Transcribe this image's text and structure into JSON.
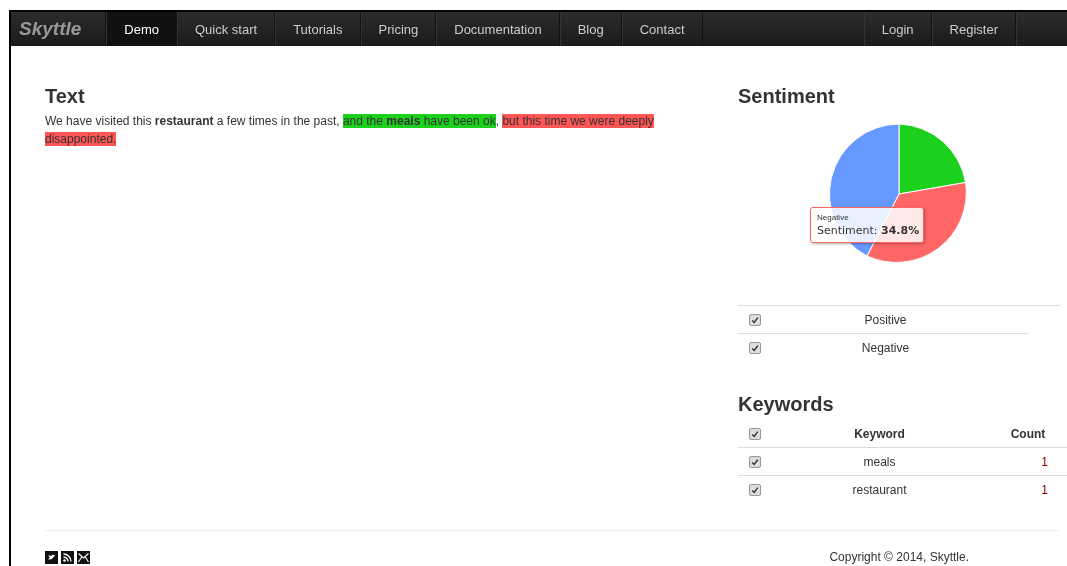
{
  "navbar": {
    "brand": "Skyttle",
    "items": [
      {
        "label": "Demo",
        "selected": true
      },
      {
        "label": "Quick start",
        "selected": false
      },
      {
        "label": "Tutorials",
        "selected": false
      },
      {
        "label": "Pricing",
        "selected": false
      },
      {
        "label": "Documentation",
        "selected": false
      },
      {
        "label": "Blog",
        "selected": false
      },
      {
        "label": "Contact",
        "selected": false
      }
    ],
    "right_items": [
      {
        "label": "Login"
      },
      {
        "label": "Register"
      }
    ]
  },
  "text_section": {
    "title": "Text",
    "segments": [
      {
        "kind": "plain",
        "text": "We have visited this **restaurant** a few times in the past, "
      },
      {
        "kind": "positive",
        "text": "and the **meals** have been ok"
      },
      {
        "kind": "plain",
        "text": ", "
      },
      {
        "kind": "negative",
        "text": "but this time we were deeply disappointed."
      }
    ]
  },
  "sentiment": {
    "title": "Sentiment",
    "tooltip": {
      "label": "Negative",
      "text": "Sentiment: ",
      "value": "34.8%"
    },
    "legend": [
      {
        "label": "Positive",
        "checked": true
      },
      {
        "label": "Negative",
        "checked": true
      }
    ]
  },
  "keywords": {
    "title": "Keywords",
    "header_checked": true,
    "columns": [
      "Keyword",
      "Count"
    ],
    "rows": [
      {
        "keyword": "meals",
        "count": "1",
        "checked": true
      },
      {
        "keyword": "restaurant",
        "count": "1",
        "checked": true
      }
    ]
  },
  "footer": {
    "copyright": "Copyright © 2014, Skyttle."
  }
}
